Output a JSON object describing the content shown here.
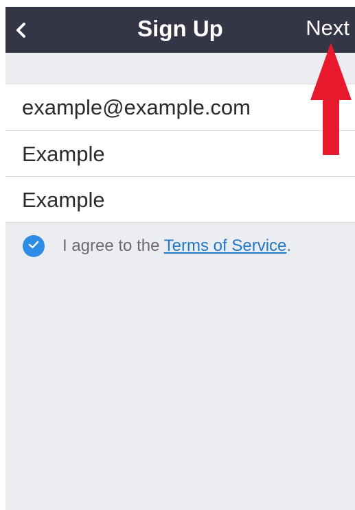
{
  "navbar": {
    "back_icon": "chevron-left-icon",
    "title": "Sign Up",
    "next_label": "Next"
  },
  "form": {
    "email_value": "example@example.com",
    "first_name_value": "Example",
    "last_name_value": "Example"
  },
  "agreement": {
    "checked": true,
    "check_icon": "checkmark-icon",
    "prefix": "I agree to the ",
    "link_text": "Terms of Service",
    "suffix": "."
  },
  "annotation": {
    "arrow_icon": "arrow-up-icon",
    "arrow_color": "#e8192c"
  },
  "colors": {
    "navbar": "#343545",
    "background": "#ebedf1",
    "accent": "#2d8ce6",
    "link": "#2277c8"
  }
}
